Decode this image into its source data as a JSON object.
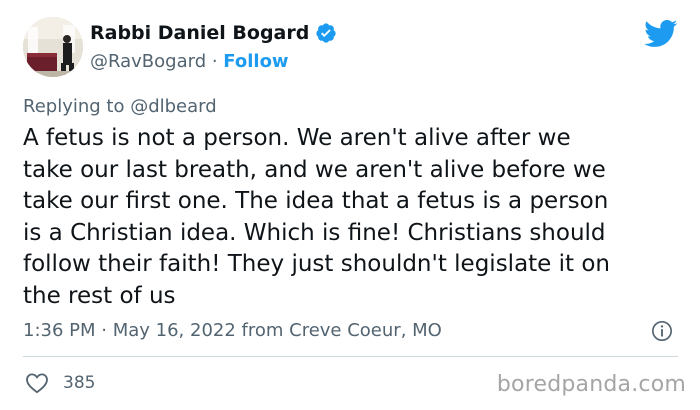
{
  "author": {
    "display_name": "Rabbi Daniel Bogard",
    "handle": "@RavBogard",
    "separator": " · ",
    "follow_label": "Follow",
    "verified": true
  },
  "reply": {
    "prefix": "Replying to ",
    "mention": "@dlbeard"
  },
  "tweet": {
    "text": "A fetus is not a person. We aren't alive after we\ntake our last breath, and we aren't alive before we\ntake our first one. The idea that a fetus is a person\nis a Christian idea. Which is fine! Christians should\nfollow their faith! They just shouldn't legislate it on\nthe rest of us"
  },
  "meta": {
    "time": "1:36 PM",
    "separator": " · ",
    "date": "May 16, 2022",
    "location": " from Creve Coeur, MO"
  },
  "actions": {
    "like_count": "385"
  },
  "watermark": "boredpanda.com",
  "colors": {
    "accent": "#1d9bf0",
    "secondary_text": "#536471",
    "primary_text": "#0f1419"
  },
  "icons": {
    "verified": "verified-badge-icon",
    "bird": "twitter-bird-icon",
    "info": "info-icon",
    "heart": "heart-icon"
  }
}
